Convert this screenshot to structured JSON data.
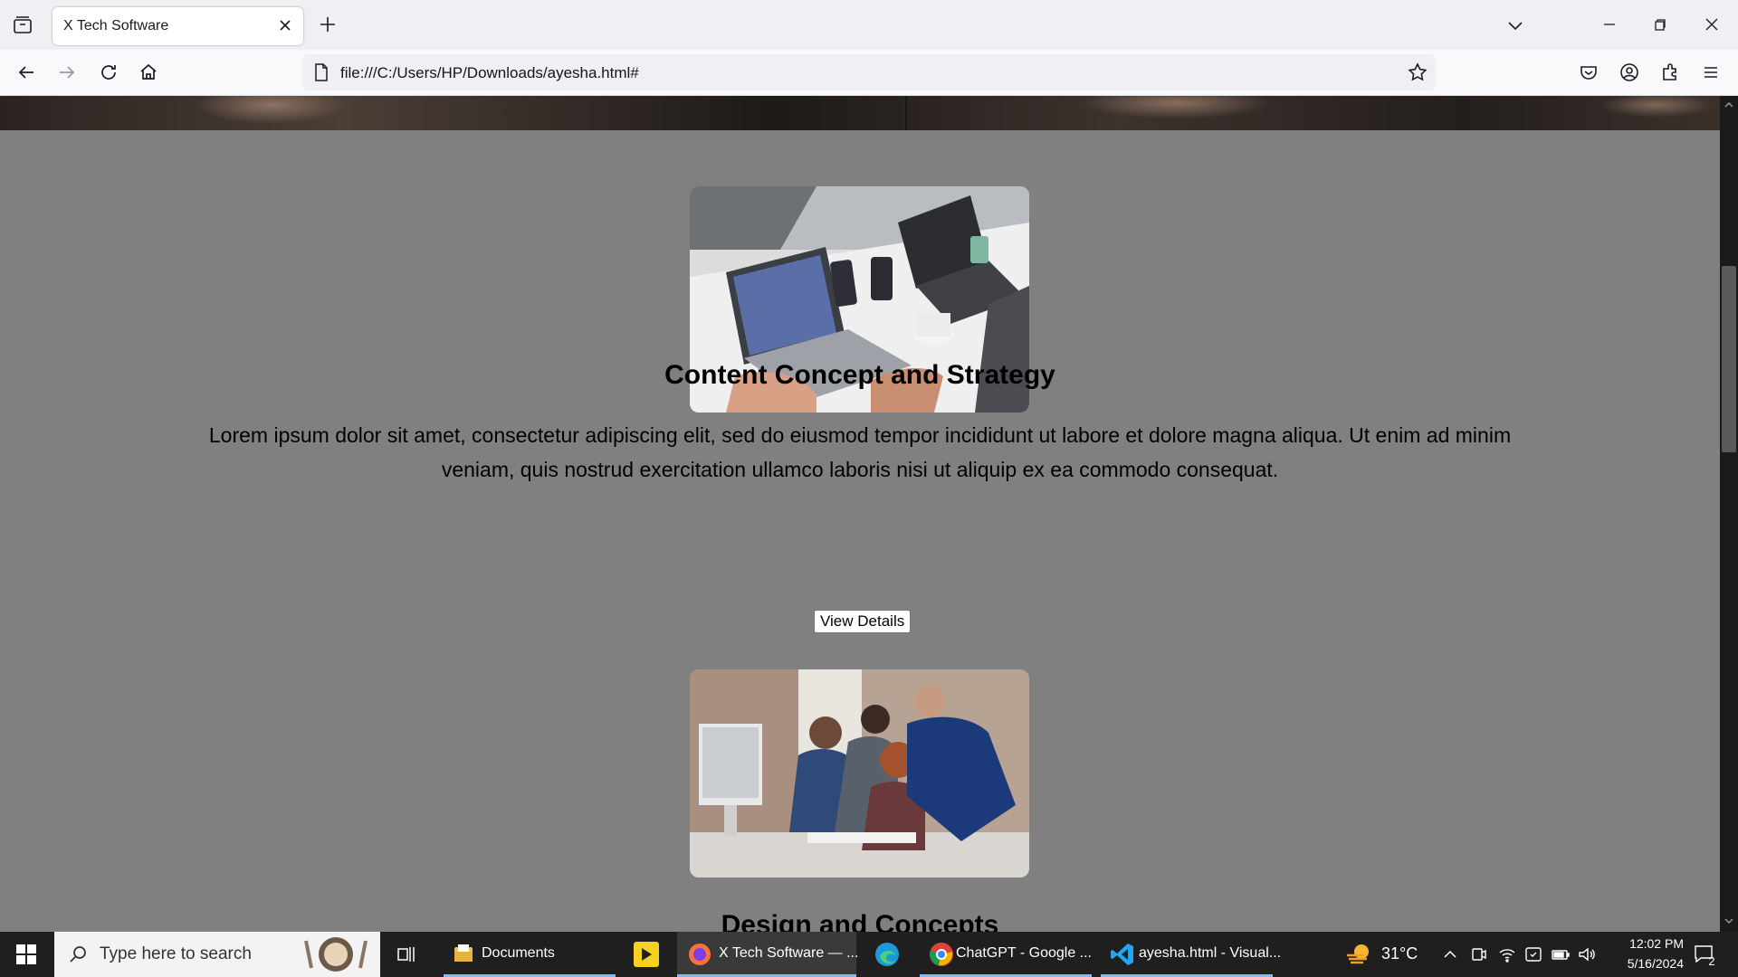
{
  "browser": {
    "tab_title": "X Tech Software",
    "url": "file:///C:/Users/HP/Downloads/ayesha.html#"
  },
  "page": {
    "sections": [
      {
        "title": "Content Concept and Strategy",
        "text": "Lorem ipsum dolor sit amet, consectetur adipiscing elit, sed do eiusmod tempor incididunt ut labore et dolore magna aliqua. Ut enim ad minim veniam, quis nostrud exercitation ullamco laboris nisi ut aliquip ex ea commodo consequat.",
        "button": "View Details"
      },
      {
        "title": "Design and Concepts"
      }
    ]
  },
  "taskbar": {
    "search_placeholder": "Type here to search",
    "items": [
      {
        "label": "Documents",
        "icon": "file-explorer-icon"
      },
      {
        "label": "",
        "icon": "player-app-icon"
      },
      {
        "label": "X Tech Software — ...",
        "icon": "firefox-icon"
      },
      {
        "label": "",
        "icon": "edge-icon"
      },
      {
        "label": "ChatGPT - Google ...",
        "icon": "chrome-icon"
      },
      {
        "label": "ayesha.html - Visual...",
        "icon": "vscode-icon"
      }
    ],
    "weather": "31°C",
    "time": "12:02 PM",
    "date": "5/16/2024",
    "notifications": "2"
  }
}
